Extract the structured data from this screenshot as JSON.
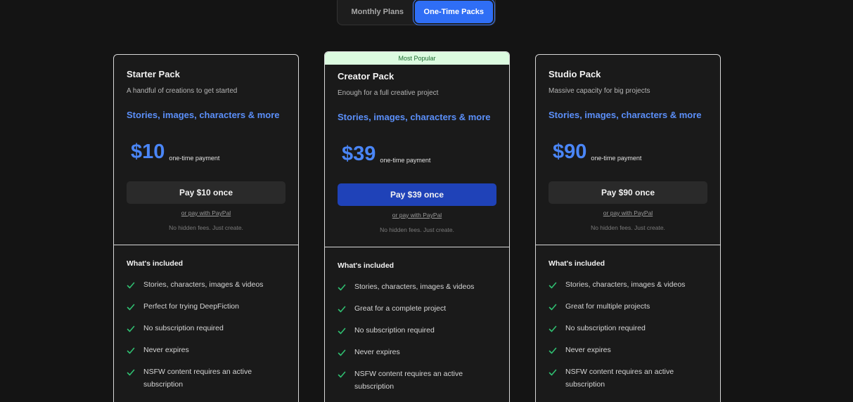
{
  "toggle": {
    "monthly_label": "Monthly Plans",
    "onetime_label": "One-Time Packs",
    "active": "One-Time Packs"
  },
  "colors": {
    "accent": "#2f6ef5",
    "price": "#4a86f7",
    "feature_link": "#5b8ff9",
    "check": "#2fbf71",
    "badge_bg": "#dcfbe0"
  },
  "included_title": "What's included",
  "paypal_label": "or pay with PayPal",
  "no_fees_label": "No hidden fees. Just create.",
  "price_note": "one-time payment",
  "cards": [
    {
      "name": "Starter Pack",
      "subtitle": "A handful of creations to get started",
      "feature_line": "Stories, images, characters & more",
      "price": "$10",
      "pay_label": "Pay $10 once",
      "features": [
        "Stories, characters, images & videos",
        "Perfect for trying DeepFiction",
        "No subscription required",
        "Never expires",
        "NSFW content requires an active subscription"
      ]
    },
    {
      "badge": "Most Popular",
      "name": "Creator Pack",
      "subtitle": "Enough for a full creative project",
      "feature_line": "Stories, images, characters & more",
      "price": "$39",
      "pay_label": "Pay $39 once",
      "features": [
        "Stories, characters, images & videos",
        "Great for a complete project",
        "No subscription required",
        "Never expires",
        "NSFW content requires an active subscription"
      ]
    },
    {
      "name": "Studio Pack",
      "subtitle": "Massive capacity for big projects",
      "feature_line": "Stories, images, characters & more",
      "price": "$90",
      "pay_label": "Pay $90 once",
      "features": [
        "Stories, characters, images & videos",
        "Great for multiple projects",
        "No subscription required",
        "Never expires",
        "NSFW content requires an active subscription"
      ]
    }
  ]
}
